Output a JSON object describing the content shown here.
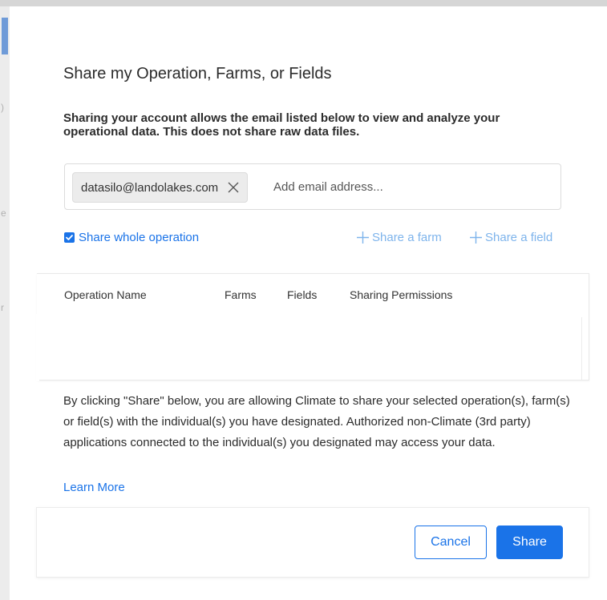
{
  "colors": {
    "accent": "#1a73e8",
    "accent_light": "#7eb4ec",
    "text": "#2b2b2b",
    "chip_bg": "#ececec",
    "border": "#dcdcdc"
  },
  "modal": {
    "title": "Share my Operation, Farms, or Fields",
    "intro": "Sharing your account allows the email listed below to view and analyze your operational data. This does not share raw data files."
  },
  "email": {
    "chips": [
      {
        "label": "datasilo@landolakes.com",
        "remove_icon": "close-icon"
      }
    ],
    "input_value": "",
    "placeholder": "Add email address..."
  },
  "share_options": {
    "whole_operation": {
      "label": "Share whole operation",
      "checked": true
    },
    "share_farm": {
      "label": "Share a farm",
      "icon": "plus-icon"
    },
    "share_field": {
      "label": "Share a field",
      "icon": "plus-icon"
    }
  },
  "table": {
    "columns": [
      "Operation Name",
      "Farms",
      "Fields",
      "Sharing Permissions"
    ],
    "rows": []
  },
  "disclaimer": {
    "text": "By clicking \"Share\" below, you are allowing Climate to share your selected operation(s), farm(s) or field(s) with the individual(s) you have designated. Authorized non-Climate (3rd party) applications connected to the individual(s) you designated may access your data.",
    "learn_more": "Learn More"
  },
  "footer": {
    "cancel_label": "Cancel",
    "share_label": "Share"
  }
}
